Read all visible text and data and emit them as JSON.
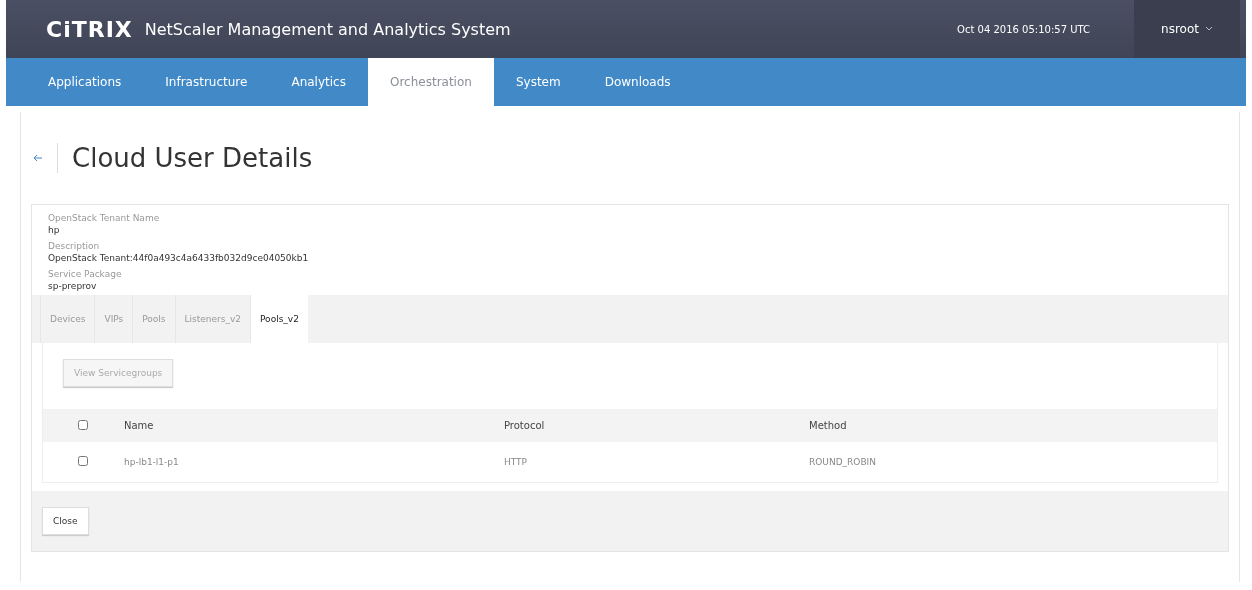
{
  "header": {
    "logo": "CiTRIX",
    "product": "NetScaler Management and Analytics System",
    "datetime": "Oct 04 2016 05:10:57 UTC",
    "user": "nsroot"
  },
  "nav": [
    {
      "label": "Applications",
      "selected": false
    },
    {
      "label": "Infrastructure",
      "selected": false
    },
    {
      "label": "Analytics",
      "selected": false
    },
    {
      "label": "Orchestration",
      "selected": true
    },
    {
      "label": "System",
      "selected": false
    },
    {
      "label": "Downloads",
      "selected": false
    }
  ],
  "page_title": "Cloud User Details",
  "details": [
    {
      "label": "OpenStack Tenant Name",
      "value": "hp"
    },
    {
      "label": "Description",
      "value": "OpenStack Tenant:44f0a493c4a6433fb032d9ce04050kb1"
    },
    {
      "label": "Service Package",
      "value": "sp-preprov"
    }
  ],
  "tabs": [
    {
      "label": "Devices",
      "selected": false
    },
    {
      "label": "VIPs",
      "selected": false
    },
    {
      "label": "Pools",
      "selected": false
    },
    {
      "label": "Listeners_v2",
      "selected": false
    },
    {
      "label": "Pools_v2",
      "selected": true
    }
  ],
  "toolbar": {
    "button": "View Servicegroups",
    "disabled": true
  },
  "table": {
    "header_checked": false,
    "columns": [
      "Name",
      "Protocol",
      "Method"
    ],
    "rows": [
      {
        "checked": false,
        "cells": [
          "hp-lb1-l1-p1",
          "HTTP",
          "ROUND_ROBIN"
        ]
      }
    ]
  },
  "footer": {
    "button": "Close"
  }
}
